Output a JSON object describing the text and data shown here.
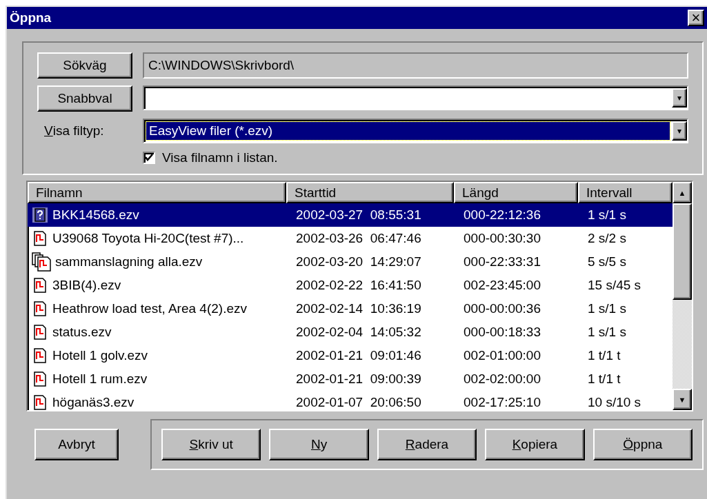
{
  "window": {
    "title": "Öppna",
    "close": "×"
  },
  "path": {
    "button": "Sökväg",
    "value": "C:\\WINDOWS\\Skrivbord\\"
  },
  "quick": {
    "button": "Snabbval",
    "arrow": "▾"
  },
  "filetype": {
    "label": "Visa filtyp:",
    "mnemonic": true,
    "value": "EasyView filer (*.ezv)",
    "arrow": "▾",
    "focused": true
  },
  "show_names": {
    "label": "Visa filnamn i listan.",
    "checked": true
  },
  "table": {
    "columns": [
      "Filnamn",
      "Starttid",
      "Längd",
      "Intervall"
    ],
    "rows": [
      {
        "kind": "unknown",
        "selected": true,
        "cells": [
          "BKK14568.ezv",
          "2002-03-27  08:55:31",
          "000-22:12:36",
          "1 s/1 s"
        ]
      },
      {
        "kind": "data",
        "selected": false,
        "cells": [
          "U39068 Toyota Hi-20C(test #7)...",
          "2002-03-26  06:47:46",
          "000-00:30:30",
          "2 s/2 s"
        ]
      },
      {
        "kind": "merged",
        "selected": false,
        "cells": [
          "sammanslagning alla.ezv",
          "2002-03-20  14:29:07",
          "000-22:33:31",
          "5 s/5 s"
        ]
      },
      {
        "kind": "data",
        "selected": false,
        "cells": [
          "3BIB(4).ezv",
          "2002-02-22  16:41:50",
          "002-23:45:00",
          "15 s/45 s"
        ]
      },
      {
        "kind": "data",
        "selected": false,
        "cells": [
          "Heathrow load test, Area 4(2).ezv",
          "2002-02-14  10:36:19",
          "000-00:00:36",
          "1 s/1 s"
        ]
      },
      {
        "kind": "data",
        "selected": false,
        "cells": [
          "status.ezv",
          "2002-02-04  14:05:32",
          "000-00:18:33",
          "1 s/1 s"
        ]
      },
      {
        "kind": "data",
        "selected": false,
        "cells": [
          "Hotell 1 golv.ezv",
          "2002-01-21  09:01:46",
          "002-01:00:00",
          "1 t/1 t"
        ]
      },
      {
        "kind": "data",
        "selected": false,
        "cells": [
          "Hotell 1 rum.ezv",
          "2002-01-21  09:00:39",
          "002-02:00:00",
          "1 t/1 t"
        ]
      },
      {
        "kind": "data",
        "selected": false,
        "cells": [
          "höganäs3.ezv",
          "2002-01-07  20:06:50",
          "002-17:25:10",
          "10 s/10 s"
        ]
      }
    ]
  },
  "scrollbar": {
    "up": "▲",
    "down": "▼"
  },
  "cancel": {
    "label": "Avbryt"
  },
  "buttons": [
    {
      "label": "Skriv ut",
      "mnemonic": true
    },
    {
      "label": "Ny",
      "mnemonic": true
    },
    {
      "label": "Radera",
      "mnemonic": true
    },
    {
      "label": "Kopiera",
      "mnemonic": true
    },
    {
      "label": "Öppna",
      "mnemonic": true
    }
  ]
}
